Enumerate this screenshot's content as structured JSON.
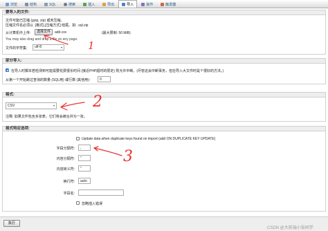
{
  "tabs": [
    {
      "label": "浏览",
      "icon": "browse-icon"
    },
    {
      "label": "结构",
      "icon": "structure-icon"
    },
    {
      "label": "SQL",
      "icon": "sql-icon"
    },
    {
      "label": "搜索",
      "icon": "search-icon"
    },
    {
      "label": "插入",
      "icon": "insert-icon"
    },
    {
      "label": "导出",
      "icon": "export-icon"
    },
    {
      "label": "导入",
      "icon": "import-icon"
    },
    {
      "label": "操作",
      "icon": "operations-icon"
    },
    {
      "label": "触发器",
      "icon": "triggers-icon"
    }
  ],
  "active_tab": "导入",
  "file_section": {
    "heading": "要导入的文件:",
    "line1": "文件可能已压缩 (gzip, zip) 或未压缩。",
    "line2": "压缩文件名必须以 .[格式].[压缩方式] 结尾。如: .sql.zip",
    "upload_label": "从计算机中上传:",
    "choose_button": "选择文件",
    "file_name": "add.csv",
    "max_size": "(最大限制: 50 MiB)",
    "drag_hint": "You may also drag and drop a file on any page.",
    "charset_label": "文件的字符集:",
    "charset_value": "utf-8"
  },
  "partial_section": {
    "heading": "部分导入:",
    "allow_interrupt_checked": true,
    "allow_interrupt_text": "在导入时脚本若检测到可能需要花费很长时间 (接近PHP超时的限定) 则允许中断。(尽管这会中断事务，但在导入大文件时是个很好的方法。)",
    "skip_label": "从第一个开始跳过查询的数量 (SQL用) 或行数 (其他用):",
    "skip_value": "0"
  },
  "format_section": {
    "heading": "格式:",
    "value": "CSV",
    "note": "注释: 如果文件包含多张表，它们将会被合并为一张。"
  },
  "format_options": {
    "heading": "格式特定选项:",
    "update_checked": false,
    "update_text": "Update data when duplicate keys found on import (add ON DUPLICATE KEY UPDATE)",
    "field_sep_label": "字段分隔符:",
    "field_sep_value": ",",
    "enclosed_label": "内容分隔符:",
    "enclosed_value": "\"",
    "escaped_label": "内容转义符:",
    "escaped_value": "\"",
    "line_term_label": "换行符:",
    "line_term_value": "auto",
    "col_names_label": "字段名:",
    "col_names_value": "",
    "ignore_errors_checked": false,
    "ignore_errors_text": "忽略插入错误"
  },
  "submit_label": "执行",
  "watermark": "CSDN @大前端小张同学",
  "annotations": {
    "one": "1",
    "two": "2",
    "three": "3"
  },
  "colors": {
    "annotation": "#e8312f",
    "link": "#235a81",
    "checkbox_checked": "#2a7ae2"
  }
}
